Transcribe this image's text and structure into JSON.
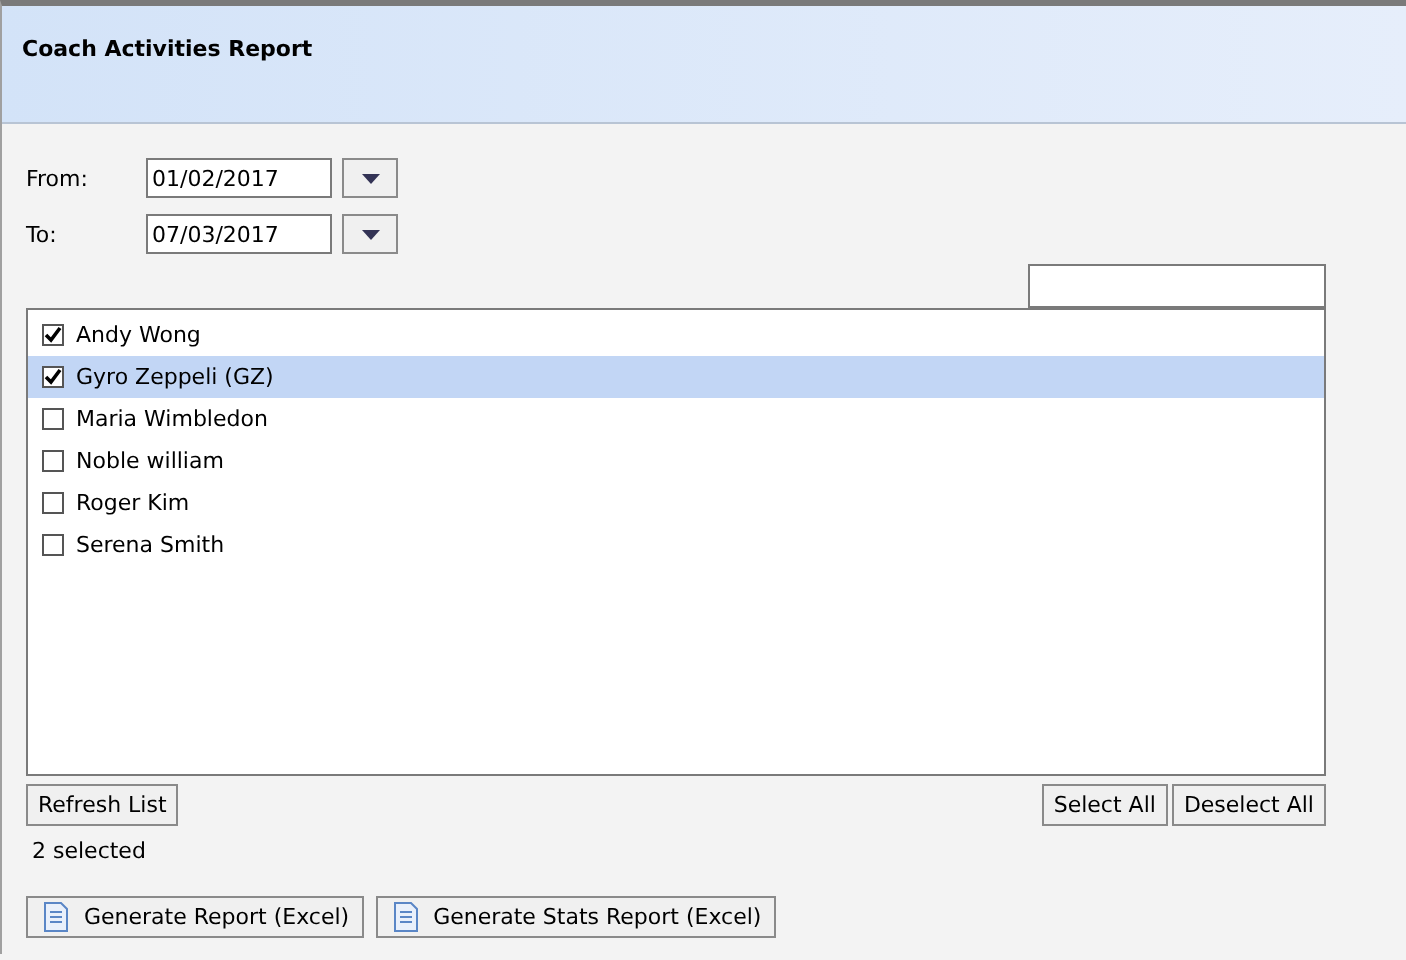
{
  "window": {
    "title": "Coach Activities Report"
  },
  "from": {
    "label": "From:",
    "value": "01/02/2017"
  },
  "to": {
    "label": "To:",
    "value": "07/03/2017"
  },
  "coaches": [
    {
      "name": "Andy Wong",
      "checked": true,
      "selected": false
    },
    {
      "name": "Gyro Zeppeli (GZ)",
      "checked": true,
      "selected": true
    },
    {
      "name": "Maria Wimbledon",
      "checked": false,
      "selected": false
    },
    {
      "name": "Noble william",
      "checked": false,
      "selected": false
    },
    {
      "name": "Roger Kim",
      "checked": false,
      "selected": false
    },
    {
      "name": "Serena Smith",
      "checked": false,
      "selected": false
    }
  ],
  "refresh_button": "Refresh List",
  "select_all_button": "Select All",
  "deselect_all_button": "Deselect All",
  "status": "2 selected",
  "report_buttons": [
    "Generate Report (Excel)",
    "Generate Stats Report (Excel)"
  ]
}
